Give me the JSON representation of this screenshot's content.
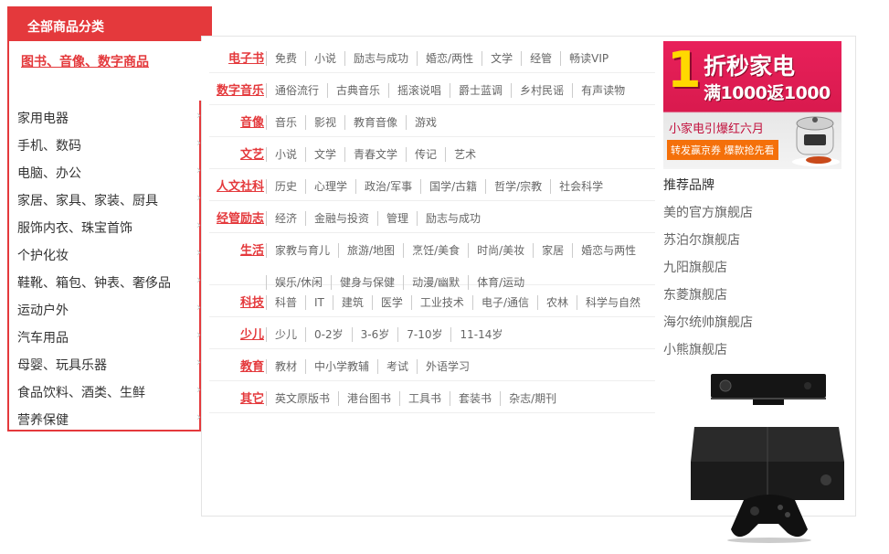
{
  "category_header": {
    "title": "全部商品分类"
  },
  "active_category": {
    "label": "图书、音像、数字商品"
  },
  "categories": [
    "家用电器",
    "手机、数码",
    "电脑、办公",
    "家居、家具、家装、厨具",
    "服饰内衣、珠宝首饰",
    "个护化妆",
    "鞋靴、箱包、钟表、奢侈品",
    "运动户外",
    "汽车用品",
    "母婴、玩具乐器",
    "食品饮料、酒类、生鲜",
    "营养保健"
  ],
  "arrow_glyph": "›",
  "subcategories": [
    {
      "title": "电子书",
      "items": [
        "免费",
        "小说",
        "励志与成功",
        "婚恋/两性",
        "文学",
        "经管",
        "畅读VIP"
      ]
    },
    {
      "title": "数字音乐",
      "items": [
        "通俗流行",
        "古典音乐",
        "摇滚说唱",
        "爵士蓝调",
        "乡村民谣",
        "有声读物"
      ]
    },
    {
      "title": "音像",
      "items": [
        "音乐",
        "影视",
        "教育音像",
        "游戏"
      ]
    },
    {
      "title": "文艺",
      "items": [
        "小说",
        "文学",
        "青春文学",
        "传记",
        "艺术"
      ]
    },
    {
      "title": "人文社科",
      "items": [
        "历史",
        "心理学",
        "政治/军事",
        "国学/古籍",
        "哲学/宗教",
        "社会科学"
      ]
    },
    {
      "title": "经管励志",
      "items": [
        "经济",
        "金融与投资",
        "管理",
        "励志与成功"
      ]
    },
    {
      "title": "生活",
      "items": [
        "家教与育儿",
        "旅游/地图",
        "烹饪/美食",
        "时尚/美妆",
        "家居",
        "婚恋与两性",
        "娱乐/休闲",
        "健身与保健",
        "动漫/幽默",
        "体育/运动"
      ]
    },
    {
      "title": "科技",
      "items": [
        "科普",
        "IT",
        "建筑",
        "医学",
        "工业技术",
        "电子/通信",
        "农林",
        "科学与自然"
      ]
    },
    {
      "title": "少儿",
      "items": [
        "少儿",
        "0-2岁",
        "3-6岁",
        "7-10岁",
        "11-14岁"
      ]
    },
    {
      "title": "教育",
      "items": [
        "教材",
        "中小学教辅",
        "考试",
        "外语学习"
      ]
    },
    {
      "title": "其它",
      "items": [
        "英文原版书",
        "港台图书",
        "工具书",
        "套装书",
        "杂志/期刊"
      ]
    }
  ],
  "ad": {
    "big_digit": "1",
    "title": "折秒家电",
    "subtitle": "满1000返1000",
    "line2": "小家电引爆红六月",
    "promo": "转发赢京券 爆款抢先看",
    "accent_color": "#e8205a"
  },
  "brands": {
    "title": "推荐品牌",
    "items": [
      "美的官方旗舰店",
      "苏泊尔旗舰店",
      "九阳旗舰店",
      "东菱旗舰店",
      "海尔统帅旗舰店",
      "小熊旗舰店"
    ]
  },
  "colors": {
    "brand_red": "#e4393c",
    "link_gray": "#666666"
  }
}
